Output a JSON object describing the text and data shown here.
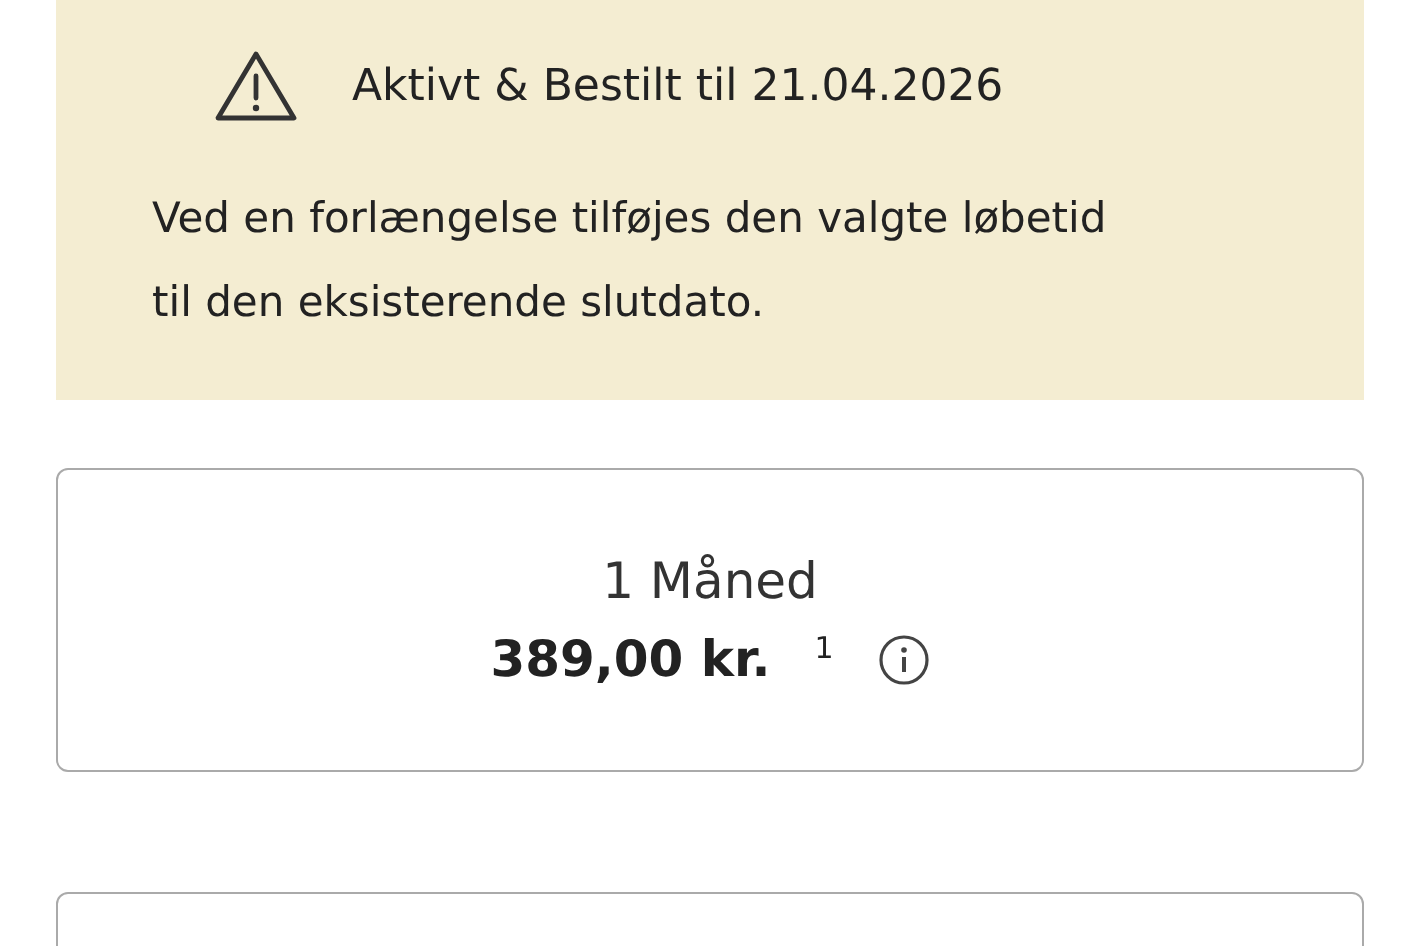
{
  "notice": {
    "title": "Aktivt & Bestilt til 21.04.2026",
    "text": "Ved en forlængelse tilføjes den valgte løbetid til den eksisterende slutdato."
  },
  "options": [
    {
      "period": "1 Måned",
      "price": "389,00 kr.",
      "footnote": "1"
    }
  ]
}
